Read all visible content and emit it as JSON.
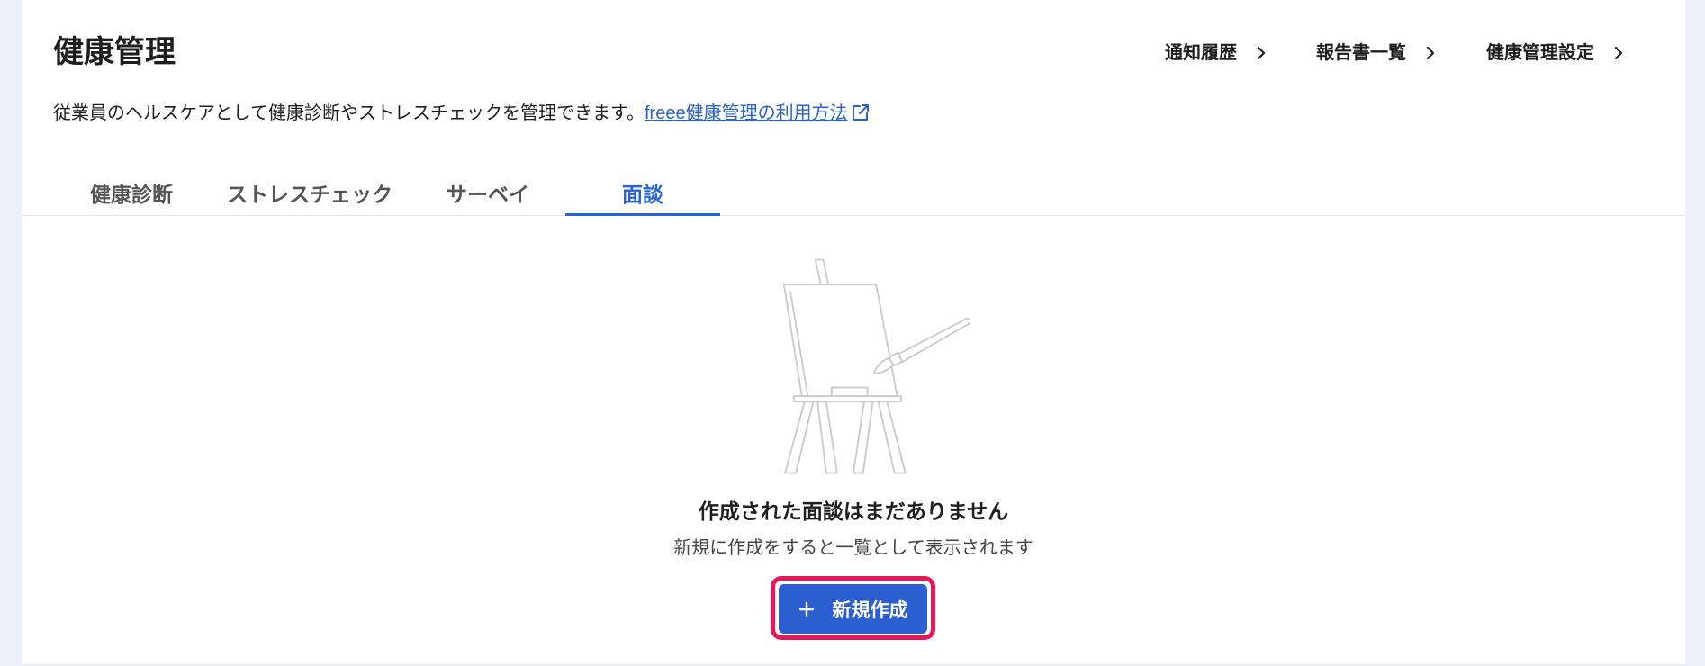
{
  "page": {
    "title": "健康管理",
    "description": "従業員のヘルスケアとして健康診断やストレスチェックを管理できます。",
    "help_link": {
      "label": "freee健康管理の利用方法",
      "icon": "external-link-icon"
    }
  },
  "header_links": [
    {
      "label": "通知履歴",
      "icon": "chevron-right-icon"
    },
    {
      "label": "報告書一覧",
      "icon": "chevron-right-icon"
    },
    {
      "label": "健康管理設定",
      "icon": "chevron-right-icon"
    }
  ],
  "tabs": [
    {
      "label": "健康診断",
      "active": false
    },
    {
      "label": "ストレスチェック",
      "active": false
    },
    {
      "label": "サーベイ",
      "active": false
    },
    {
      "label": "面談",
      "active": true
    }
  ],
  "empty_state": {
    "illustration": "easel-illustration",
    "title": "作成された面談はまだありません",
    "message": "新規に作成をすると一覧として表示されます",
    "create_button": {
      "label": "新規作成",
      "icon": "plus-icon"
    }
  },
  "colors": {
    "background": "#ebf1fb",
    "panel": "#ffffff",
    "text": "#1e1e1e",
    "muted": "#555555",
    "accent": "#2864d8",
    "link": "#2a62c9",
    "button": "#2b5fcf",
    "highlight": "#e6185c",
    "illustration": "#cccccc",
    "divider": "#e4e4e4"
  }
}
